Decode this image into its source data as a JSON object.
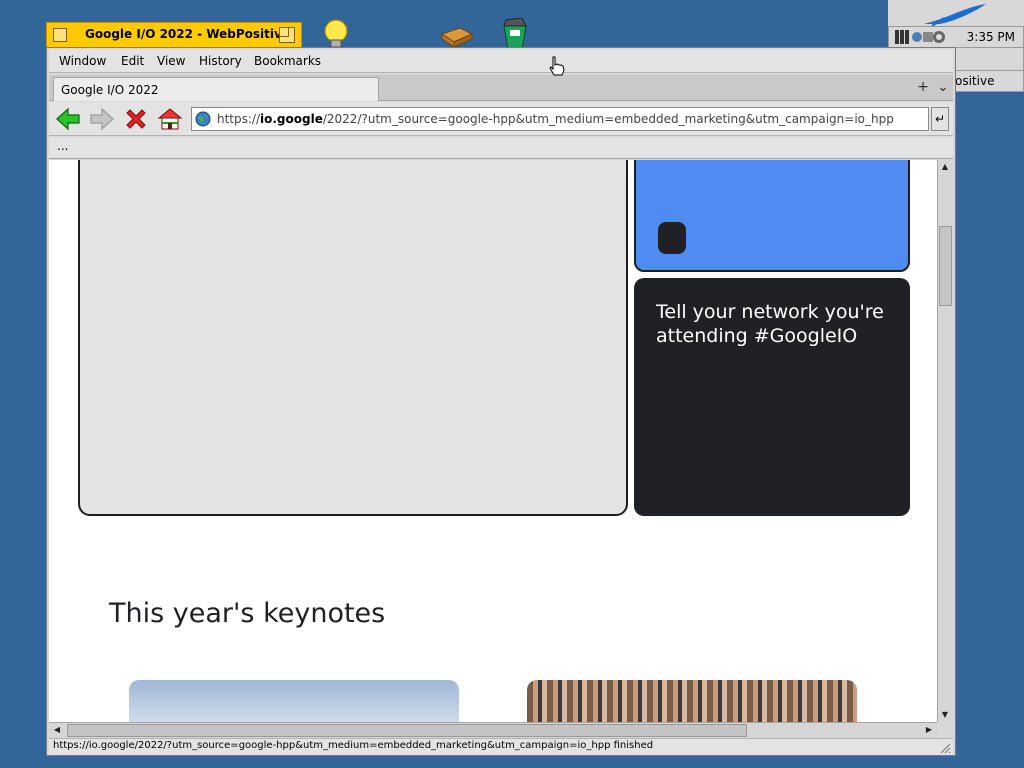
{
  "window": {
    "title": "Google I/O 2022 - WebPositive"
  },
  "menu": [
    "Window",
    "Edit",
    "View",
    "History",
    "Bookmarks"
  ],
  "tabs": [
    {
      "label": "Google I/O 2022"
    }
  ],
  "tab_controls": {
    "add": "+",
    "more": "⌄"
  },
  "url": {
    "prefix": "https://",
    "host": "io.google",
    "path": "/2022/?utm_source=google-hpp&utm_medium=embedded_marketing&utm_campaign=io_hpp",
    "go": "↵"
  },
  "bookmarks": {
    "more": "..."
  },
  "page": {
    "card_dark_text": "Tell your network you're attending #GoogleIO",
    "section_title": "This year's keynotes"
  },
  "status": "https://io.google/2022/?utm_source=google-hpp&utm_medium=embedded_marketing&utm_campaign=io_hpp finished",
  "deskbar": {
    "clock": "3:35 PM",
    "item_label": "ositive",
    "colors": {
      "logo_feather": "#1c6fd0"
    }
  },
  "icons": {
    "back": "green-left-arrow",
    "forward": "grey-right-arrow",
    "stop": "red-x",
    "home": "house",
    "site": "globe"
  }
}
